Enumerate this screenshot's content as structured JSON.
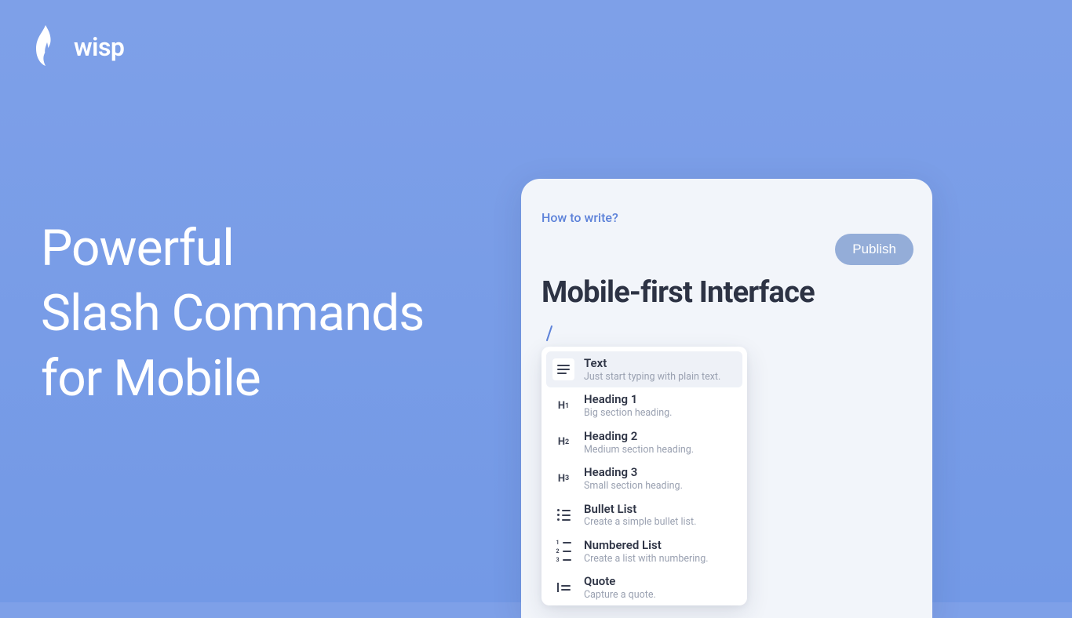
{
  "brand": {
    "name": "wisp"
  },
  "headline": {
    "line1": "Powerful",
    "line2": "Slash Commands",
    "line3": "for Mobile"
  },
  "editor": {
    "help_link": "How to write?",
    "publish_label": "Publish",
    "title": "Mobile-first Interface",
    "slash_input": "/"
  },
  "command_menu": {
    "selected_index": 0,
    "items": [
      {
        "icon": "text-icon",
        "title": "Text",
        "desc": "Just start typing with plain text."
      },
      {
        "icon": "h1-icon",
        "title": "Heading 1",
        "desc": "Big section heading."
      },
      {
        "icon": "h2-icon",
        "title": "Heading 2",
        "desc": "Medium section heading."
      },
      {
        "icon": "h3-icon",
        "title": "Heading 3",
        "desc": "Small section heading."
      },
      {
        "icon": "bullet-list-icon",
        "title": "Bullet List",
        "desc": "Create a simple bullet list."
      },
      {
        "icon": "numbered-list-icon",
        "title": "Numbered List",
        "desc": "Create a list with numbering."
      },
      {
        "icon": "quote-icon",
        "title": "Quote",
        "desc": "Capture a quote."
      }
    ]
  }
}
